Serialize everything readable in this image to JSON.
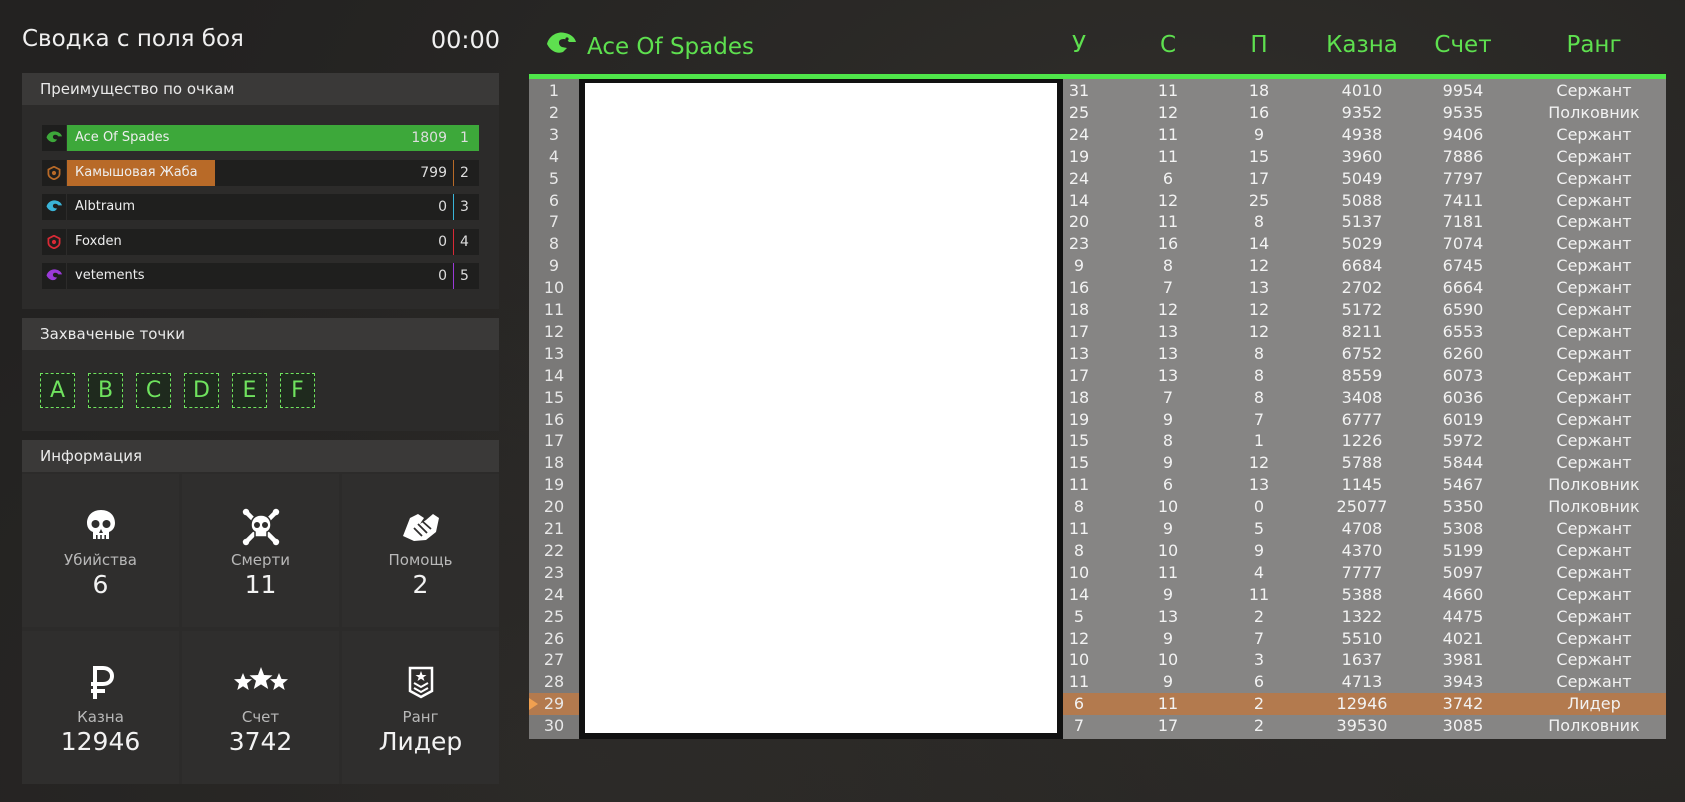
{
  "summary": {
    "title": "Сводка с поля боя",
    "timer": "00:00"
  },
  "advantage_panel": {
    "heading": "Преимущество по очкам",
    "teams": [
      {
        "name": "Ace Of Spades",
        "score": "1809",
        "rank": "1",
        "color": "#3da83a",
        "fraction": 1.0,
        "icon": "eagle-icon"
      },
      {
        "name": "Камышовая Жаба",
        "score": "799",
        "rank": "2",
        "color": "#b86a28",
        "fraction": 0.44,
        "icon": "badge-icon"
      },
      {
        "name": "Albtraum",
        "score": "0",
        "rank": "3",
        "color": "#3ab4d8",
        "fraction": 0,
        "icon": "eagle-icon"
      },
      {
        "name": "Foxden",
        "score": "0",
        "rank": "4",
        "color": "#d82a36",
        "fraction": 0,
        "icon": "badge-icon"
      },
      {
        "name": "vetements",
        "score": "0",
        "rank": "5",
        "color": "#9a3ad8",
        "fraction": 0,
        "icon": "eagle-icon"
      }
    ]
  },
  "points_panel": {
    "heading": "Захваченые точки",
    "points": [
      "A",
      "B",
      "C",
      "D",
      "E",
      "F"
    ]
  },
  "info_panel": {
    "heading": "Информация",
    "stats": [
      {
        "label": "Убийства",
        "value": "6",
        "icon": "skull-icon"
      },
      {
        "label": "Смерти",
        "value": "11",
        "icon": "skull-crossbones-icon"
      },
      {
        "label": "Помощь",
        "value": "2",
        "icon": "handshake-icon"
      },
      {
        "label": "Казна",
        "value": "12946",
        "icon": "ruble-icon"
      },
      {
        "label": "Счет",
        "value": "3742",
        "icon": "stars-icon"
      },
      {
        "label": "Ранг",
        "value": "Лидер",
        "icon": "rank-chevron-icon"
      }
    ]
  },
  "scoreboard": {
    "team_name": "Ace Of Spades",
    "columns": {
      "kills": "У",
      "deaths": "С",
      "assists": "П",
      "treasury": "Казна",
      "score": "Счет",
      "rank": "Ранг"
    },
    "highlight_row": 29,
    "rows": [
      [
        "1",
        "31",
        "11",
        "18",
        "4010",
        "9954",
        "Сержант"
      ],
      [
        "2",
        "25",
        "12",
        "16",
        "9352",
        "9535",
        "Полковник"
      ],
      [
        "3",
        "24",
        "11",
        "9",
        "4938",
        "9406",
        "Сержант"
      ],
      [
        "4",
        "19",
        "11",
        "15",
        "3960",
        "7886",
        "Сержант"
      ],
      [
        "5",
        "24",
        "6",
        "17",
        "5049",
        "7797",
        "Сержант"
      ],
      [
        "6",
        "14",
        "12",
        "25",
        "5088",
        "7411",
        "Сержант"
      ],
      [
        "7",
        "20",
        "11",
        "8",
        "5137",
        "7181",
        "Сержант"
      ],
      [
        "8",
        "23",
        "16",
        "14",
        "5029",
        "7074",
        "Сержант"
      ],
      [
        "9",
        "9",
        "8",
        "12",
        "6684",
        "6745",
        "Сержант"
      ],
      [
        "10",
        "16",
        "7",
        "13",
        "2702",
        "6664",
        "Сержант"
      ],
      [
        "11",
        "18",
        "12",
        "12",
        "5172",
        "6590",
        "Сержант"
      ],
      [
        "12",
        "17",
        "13",
        "12",
        "8211",
        "6553",
        "Сержант"
      ],
      [
        "13",
        "13",
        "13",
        "8",
        "6752",
        "6260",
        "Сержант"
      ],
      [
        "14",
        "17",
        "13",
        "8",
        "8559",
        "6073",
        "Сержант"
      ],
      [
        "15",
        "18",
        "7",
        "8",
        "3408",
        "6036",
        "Сержант"
      ],
      [
        "16",
        "19",
        "9",
        "7",
        "6777",
        "6019",
        "Сержант"
      ],
      [
        "17",
        "15",
        "8",
        "1",
        "1226",
        "5972",
        "Сержант"
      ],
      [
        "18",
        "15",
        "9",
        "12",
        "5788",
        "5844",
        "Сержант"
      ],
      [
        "19",
        "11",
        "6",
        "13",
        "1145",
        "5467",
        "Полковник"
      ],
      [
        "20",
        "8",
        "10",
        "0",
        "25077",
        "5350",
        "Полковник"
      ],
      [
        "21",
        "11",
        "9",
        "5",
        "4708",
        "5308",
        "Сержант"
      ],
      [
        "22",
        "8",
        "10",
        "9",
        "4370",
        "5199",
        "Сержант"
      ],
      [
        "23",
        "10",
        "11",
        "4",
        "7777",
        "5097",
        "Сержант"
      ],
      [
        "24",
        "14",
        "9",
        "11",
        "5388",
        "4660",
        "Сержант"
      ],
      [
        "25",
        "5",
        "13",
        "2",
        "1322",
        "4475",
        "Сержант"
      ],
      [
        "26",
        "12",
        "9",
        "7",
        "5510",
        "4021",
        "Сержант"
      ],
      [
        "27",
        "10",
        "10",
        "3",
        "1637",
        "3981",
        "Сержант"
      ],
      [
        "28",
        "11",
        "9",
        "6",
        "4713",
        "3943",
        "Сержант"
      ],
      [
        "29",
        "6",
        "11",
        "2",
        "12946",
        "3742",
        "Лидер"
      ],
      [
        "30",
        "7",
        "17",
        "2",
        "39530",
        "3085",
        "Полковник"
      ]
    ]
  }
}
